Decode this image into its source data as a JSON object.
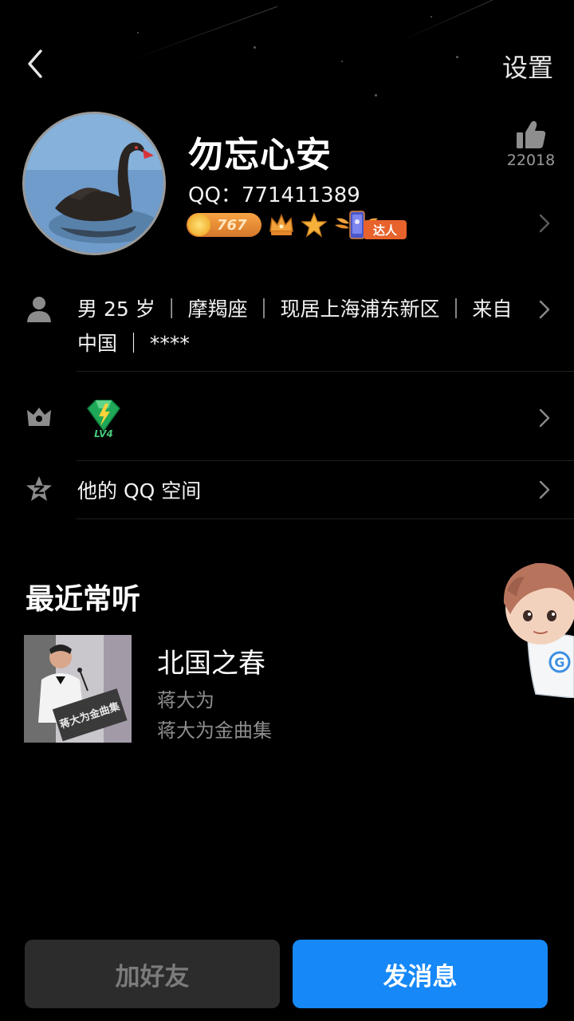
{
  "nav": {
    "back_icon": "chevron-left-icon",
    "settings_label": "设置"
  },
  "profile": {
    "nickname": "勿忘心安",
    "qq_number": "QQ：771411389",
    "like_count": "22018",
    "coin_level": "767",
    "talent_tag": "达人"
  },
  "info": {
    "details": "男 25 岁 ｜ 摩羯座 ｜ 现居上海浦东新区 ｜ 来自中国 ｜ ****"
  },
  "vip": {
    "level": "LV4"
  },
  "qzone": {
    "label": "他的 QQ 空间"
  },
  "recent": {
    "title": "最近常听",
    "song": {
      "title": "北国之春",
      "artist": "蒋大为",
      "album": "蒋大为金曲集",
      "cover_caption": "蒋大为金曲集"
    }
  },
  "actions": {
    "add_friend": "加好友",
    "send_message": "发消息"
  },
  "colors": {
    "background": "#000000",
    "primary_button": "#1688f7",
    "secondary_button": "#2c2c2c",
    "coin_badge": "#e88a36",
    "talent_tag": "#e8622c"
  }
}
